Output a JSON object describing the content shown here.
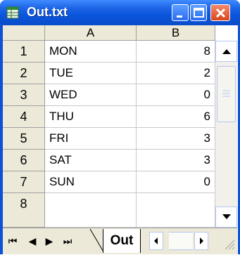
{
  "window": {
    "title": "Out.txt"
  },
  "columns": [
    "A",
    "B"
  ],
  "rows": [
    {
      "n": "1",
      "a": "MON",
      "b": "8"
    },
    {
      "n": "2",
      "a": "TUE",
      "b": "2"
    },
    {
      "n": "3",
      "a": "WED",
      "b": "0"
    },
    {
      "n": "4",
      "a": "THU",
      "b": "6"
    },
    {
      "n": "5",
      "a": "FRI",
      "b": "3"
    },
    {
      "n": "6",
      "a": "SAT",
      "b": "3"
    },
    {
      "n": "7",
      "a": "SUN",
      "b": "0"
    },
    {
      "n": "8",
      "a": "",
      "b": ""
    }
  ],
  "sheet_tab": {
    "label": "Out"
  },
  "nav": {
    "first": "⏮",
    "prev": "◀",
    "next": "▶",
    "last": "⏭"
  },
  "icons": {
    "app": "excel-sheet-icon",
    "minimize": "minimize-icon",
    "maximize": "maximize-icon",
    "close": "close-icon"
  },
  "colors": {
    "titlebar": "#0a55dc",
    "header_bg": "#ece9d8",
    "close": "#d9461f"
  }
}
